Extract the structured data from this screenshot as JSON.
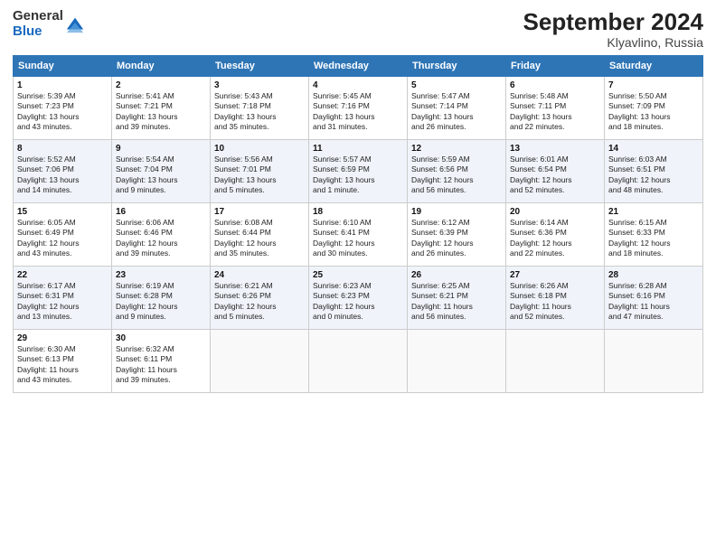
{
  "header": {
    "logo_line1": "General",
    "logo_line2": "Blue",
    "title": "September 2024",
    "subtitle": "Klyavlino, Russia"
  },
  "days_of_week": [
    "Sunday",
    "Monday",
    "Tuesday",
    "Wednesday",
    "Thursday",
    "Friday",
    "Saturday"
  ],
  "weeks": [
    [
      {
        "day": "1",
        "info": "Sunrise: 5:39 AM\nSunset: 7:23 PM\nDaylight: 13 hours\nand 43 minutes."
      },
      {
        "day": "2",
        "info": "Sunrise: 5:41 AM\nSunset: 7:21 PM\nDaylight: 13 hours\nand 39 minutes."
      },
      {
        "day": "3",
        "info": "Sunrise: 5:43 AM\nSunset: 7:18 PM\nDaylight: 13 hours\nand 35 minutes."
      },
      {
        "day": "4",
        "info": "Sunrise: 5:45 AM\nSunset: 7:16 PM\nDaylight: 13 hours\nand 31 minutes."
      },
      {
        "day": "5",
        "info": "Sunrise: 5:47 AM\nSunset: 7:14 PM\nDaylight: 13 hours\nand 26 minutes."
      },
      {
        "day": "6",
        "info": "Sunrise: 5:48 AM\nSunset: 7:11 PM\nDaylight: 13 hours\nand 22 minutes."
      },
      {
        "day": "7",
        "info": "Sunrise: 5:50 AM\nSunset: 7:09 PM\nDaylight: 13 hours\nand 18 minutes."
      }
    ],
    [
      {
        "day": "8",
        "info": "Sunrise: 5:52 AM\nSunset: 7:06 PM\nDaylight: 13 hours\nand 14 minutes."
      },
      {
        "day": "9",
        "info": "Sunrise: 5:54 AM\nSunset: 7:04 PM\nDaylight: 13 hours\nand 9 minutes."
      },
      {
        "day": "10",
        "info": "Sunrise: 5:56 AM\nSunset: 7:01 PM\nDaylight: 13 hours\nand 5 minutes."
      },
      {
        "day": "11",
        "info": "Sunrise: 5:57 AM\nSunset: 6:59 PM\nDaylight: 13 hours\nand 1 minute."
      },
      {
        "day": "12",
        "info": "Sunrise: 5:59 AM\nSunset: 6:56 PM\nDaylight: 12 hours\nand 56 minutes."
      },
      {
        "day": "13",
        "info": "Sunrise: 6:01 AM\nSunset: 6:54 PM\nDaylight: 12 hours\nand 52 minutes."
      },
      {
        "day": "14",
        "info": "Sunrise: 6:03 AM\nSunset: 6:51 PM\nDaylight: 12 hours\nand 48 minutes."
      }
    ],
    [
      {
        "day": "15",
        "info": "Sunrise: 6:05 AM\nSunset: 6:49 PM\nDaylight: 12 hours\nand 43 minutes."
      },
      {
        "day": "16",
        "info": "Sunrise: 6:06 AM\nSunset: 6:46 PM\nDaylight: 12 hours\nand 39 minutes."
      },
      {
        "day": "17",
        "info": "Sunrise: 6:08 AM\nSunset: 6:44 PM\nDaylight: 12 hours\nand 35 minutes."
      },
      {
        "day": "18",
        "info": "Sunrise: 6:10 AM\nSunset: 6:41 PM\nDaylight: 12 hours\nand 30 minutes."
      },
      {
        "day": "19",
        "info": "Sunrise: 6:12 AM\nSunset: 6:39 PM\nDaylight: 12 hours\nand 26 minutes."
      },
      {
        "day": "20",
        "info": "Sunrise: 6:14 AM\nSunset: 6:36 PM\nDaylight: 12 hours\nand 22 minutes."
      },
      {
        "day": "21",
        "info": "Sunrise: 6:15 AM\nSunset: 6:33 PM\nDaylight: 12 hours\nand 18 minutes."
      }
    ],
    [
      {
        "day": "22",
        "info": "Sunrise: 6:17 AM\nSunset: 6:31 PM\nDaylight: 12 hours\nand 13 minutes."
      },
      {
        "day": "23",
        "info": "Sunrise: 6:19 AM\nSunset: 6:28 PM\nDaylight: 12 hours\nand 9 minutes."
      },
      {
        "day": "24",
        "info": "Sunrise: 6:21 AM\nSunset: 6:26 PM\nDaylight: 12 hours\nand 5 minutes."
      },
      {
        "day": "25",
        "info": "Sunrise: 6:23 AM\nSunset: 6:23 PM\nDaylight: 12 hours\nand 0 minutes."
      },
      {
        "day": "26",
        "info": "Sunrise: 6:25 AM\nSunset: 6:21 PM\nDaylight: 11 hours\nand 56 minutes."
      },
      {
        "day": "27",
        "info": "Sunrise: 6:26 AM\nSunset: 6:18 PM\nDaylight: 11 hours\nand 52 minutes."
      },
      {
        "day": "28",
        "info": "Sunrise: 6:28 AM\nSunset: 6:16 PM\nDaylight: 11 hours\nand 47 minutes."
      }
    ],
    [
      {
        "day": "29",
        "info": "Sunrise: 6:30 AM\nSunset: 6:13 PM\nDaylight: 11 hours\nand 43 minutes."
      },
      {
        "day": "30",
        "info": "Sunrise: 6:32 AM\nSunset: 6:11 PM\nDaylight: 11 hours\nand 39 minutes."
      },
      {
        "day": "",
        "info": ""
      },
      {
        "day": "",
        "info": ""
      },
      {
        "day": "",
        "info": ""
      },
      {
        "day": "",
        "info": ""
      },
      {
        "day": "",
        "info": ""
      }
    ]
  ]
}
